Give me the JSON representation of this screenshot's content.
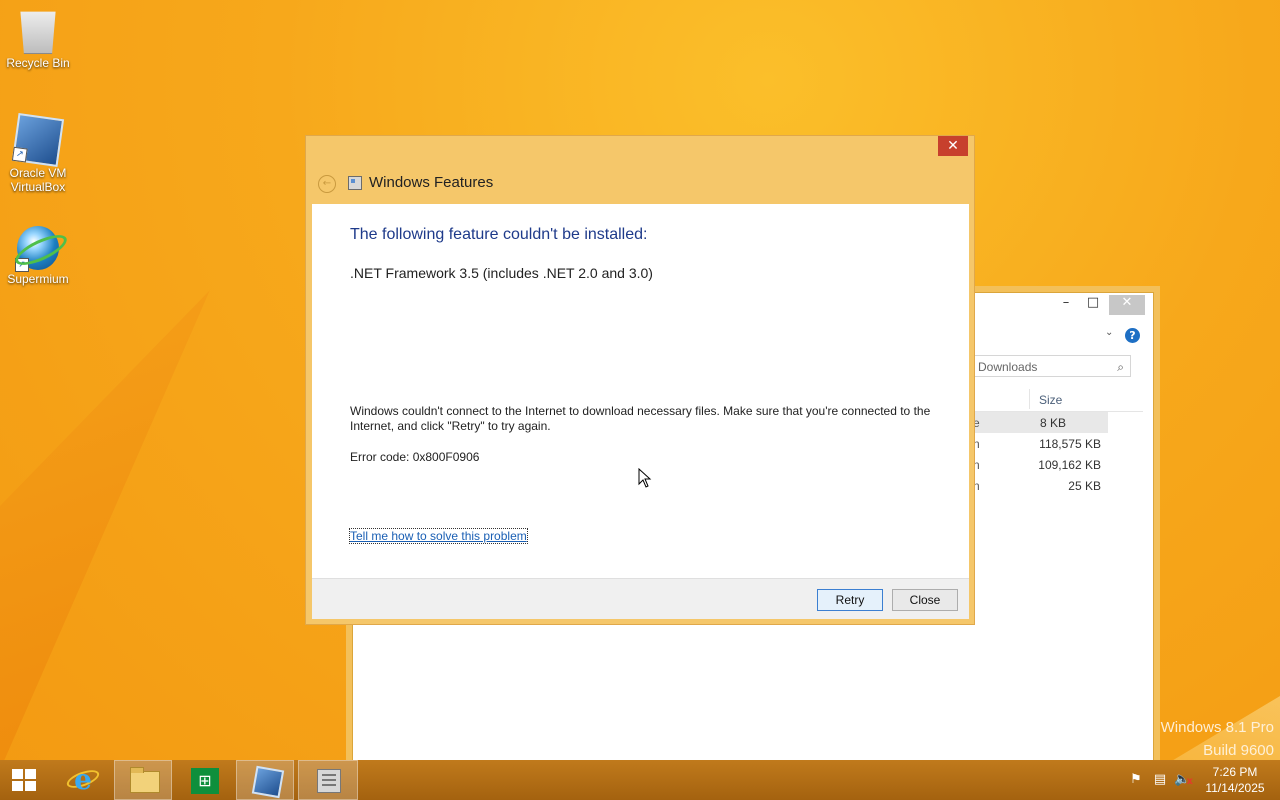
{
  "desktop": {
    "icons": [
      {
        "label": "Recycle Bin",
        "icon": "recycle-bin-icon"
      },
      {
        "label": "Oracle VM VirtualBox",
        "icon": "virtualbox-icon"
      },
      {
        "label": "Supermium",
        "icon": "supermium-icon"
      }
    ],
    "watermark": {
      "line1": "Windows 8.1 Pro",
      "line2": "Build 9600"
    }
  },
  "explorer": {
    "search_placeholder": "Downloads",
    "columns": {
      "size": "Size"
    },
    "rows": [
      {
        "cut_text": "e",
        "size": "8 KB",
        "selected": true
      },
      {
        "cut_text": "n",
        "size": "118,575 KB"
      },
      {
        "cut_text": "n",
        "size": "109,162 KB"
      },
      {
        "cut_text": "n",
        "size": "25 KB"
      }
    ],
    "controls": {
      "minimize": "–",
      "maximize": "□",
      "close": "✕",
      "help": "?"
    }
  },
  "dialog": {
    "title": "Windows Features",
    "close_glyph": "✕",
    "back_glyph": "←",
    "heading": "The following feature couldn't be installed:",
    "feature": ".NET Framework 3.5 (includes .NET 2.0 and 3.0)",
    "message": "Windows couldn't connect to the Internet to download necessary files. Make sure that you're connected to the Internet, and click \"Retry\" to try again.",
    "error_code": "Error code: 0x800F0906",
    "help_link": "Tell me how to solve this problem",
    "buttons": {
      "retry": "Retry",
      "close": "Close"
    }
  },
  "taskbar": {
    "apps": [
      {
        "name": "start-button"
      },
      {
        "name": "internet-explorer"
      },
      {
        "name": "file-explorer"
      },
      {
        "name": "windows-store"
      },
      {
        "name": "virtualbox"
      },
      {
        "name": "windows-features",
        "active": true
      }
    ],
    "tray": {
      "flag": "⚑",
      "network": "▤",
      "volume": "🔈",
      "mute": "x"
    },
    "clock": {
      "time": "7:26 PM",
      "date": "11/14/2025"
    }
  },
  "colors": {
    "accent": "#f5c76a",
    "close_red": "#c7402d",
    "heading_blue": "#1e3a8a",
    "link_blue": "#1a5fb4",
    "taskbar": "#b26d14"
  }
}
